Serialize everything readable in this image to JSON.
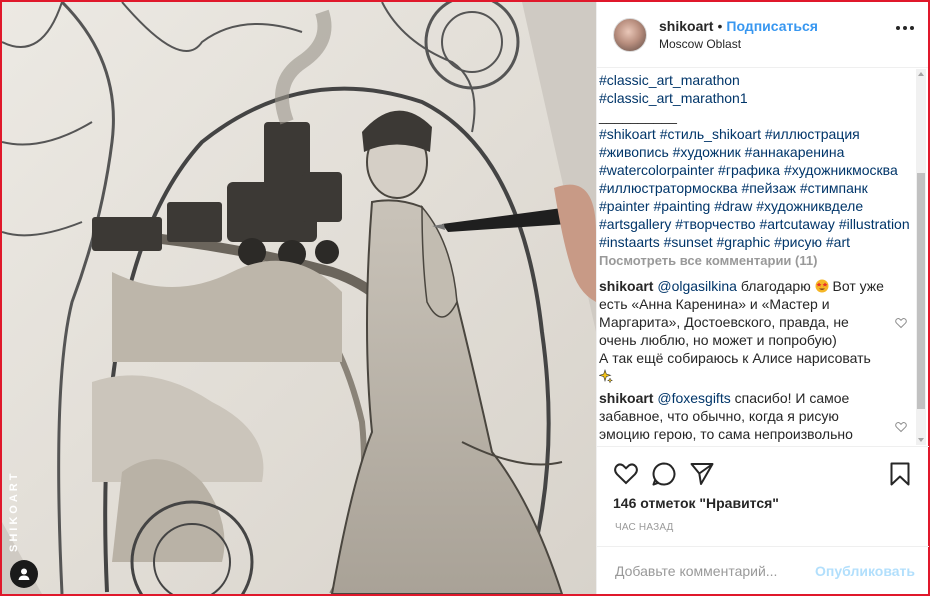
{
  "post": {
    "username": "shikoart",
    "separator": "•",
    "follow_label": "Подписаться",
    "location": "Moscow Oblast",
    "more_icon": "more-horizontal-icon",
    "watermark": "SHIKOART"
  },
  "caption_lines": [
    "#classic_art_marathon",
    "#classic_art_marathon1",
    "__________",
    "#shikoart #стиль_shikoart #иллюстрация",
    "#живопись #художник #аннакаренина",
    "#watercolorpainter #графика #художникмосква",
    "#иллюстратормосква #пейзаж #стимпанк",
    "#painter #painting #draw #художниквделе",
    "#artsgallery #творчество #artcutaway #illustration",
    "#instaarts #sunset #graphic #рисую #art"
  ],
  "view_all_comments": "Посмотреть все комментарии (11)",
  "comments": [
    {
      "user": "shikoart",
      "mention": "@olgasilkina",
      "text_before_emoji": "благодарю",
      "text_after_emoji": "Вот уже есть «Анна Каренина» и «Мастер и Маргарита», Достоевского, правда, не очень люблю, но может и попробую)",
      "text_line2": "А так ещё собираюсь к Алисе нарисовать"
    },
    {
      "user": "shikoart",
      "mention": "@foxesgifts",
      "text": "спасибо! И самое забавное, что обычно, когда я рисую эмоцию герою, то сама непроизвольно"
    }
  ],
  "actions": {
    "like_icon": "heart-icon",
    "comment_icon": "comment-icon",
    "share_icon": "send-icon",
    "save_icon": "bookmark-icon"
  },
  "likes": "146 отметок \"Нравится\"",
  "time": "час назад",
  "add_comment": {
    "placeholder": "Добавьте комментарий...",
    "publish_label": "Опубликовать"
  },
  "colors": {
    "accent_blue": "#3897f0",
    "hashtag_blue": "#003569",
    "muted_gray": "#999999",
    "publish_disabled": "#b2dffc",
    "frame_red": "#e0182b"
  }
}
